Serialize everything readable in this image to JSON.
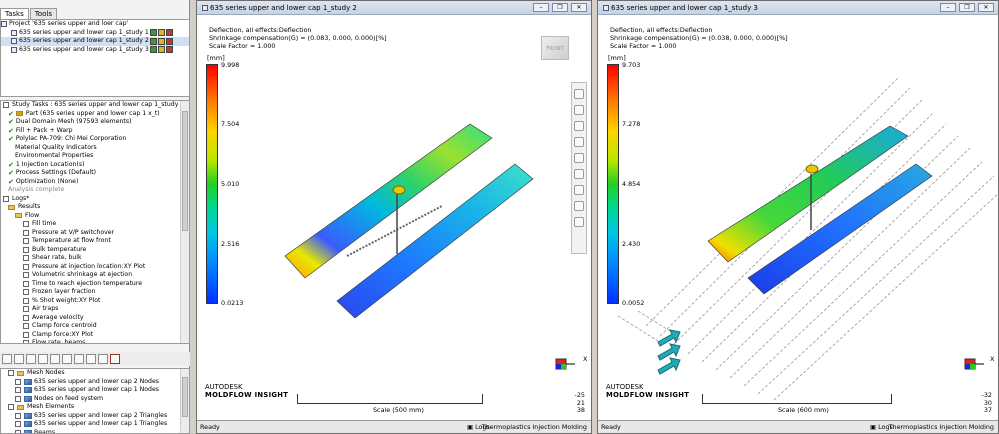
{
  "left": {
    "tabs": [
      "Tasks",
      "Tools"
    ],
    "project": {
      "title": "Project '635 series  upper and loer cap'",
      "studies": [
        {
          "label": "635 series  upper and lower cap 1_study 1",
          "selected": false
        },
        {
          "label": "635 series  upper and lower cap 1_study 2",
          "selected": true
        },
        {
          "label": "635 series  upper and lower cap 1_study 3",
          "selected": false
        }
      ]
    },
    "tasks": {
      "header": "Study Tasks : 635 series  upper and lower cap 1_study 2",
      "items": [
        {
          "label": "Part (635 series  upper and lower cap 1 x_t)",
          "indent": 1,
          "kind": "part"
        },
        {
          "label": "Dual Domain Mesh (97593 elements)",
          "indent": 1,
          "kind": "tick"
        },
        {
          "label": "Fill + Pack + Warp",
          "indent": 1,
          "kind": "tick"
        },
        {
          "label": "Polylac PA-709: Chi Mei Corporation",
          "indent": 1,
          "kind": "tick"
        },
        {
          "label": "Material Quality Indicators",
          "indent": 2,
          "kind": "none"
        },
        {
          "label": "Environmental Properties",
          "indent": 2,
          "kind": "none"
        },
        {
          "label": "1 Injection Location(s)",
          "indent": 1,
          "kind": "tick"
        },
        {
          "label": "Process Settings (Default)",
          "indent": 1,
          "kind": "tick"
        },
        {
          "label": "Optimization (None)",
          "indent": 1,
          "kind": "tick"
        },
        {
          "label": "Analysis complete",
          "indent": 1,
          "kind": "grey"
        },
        {
          "label": "Logs*",
          "indent": 0,
          "kind": "box"
        },
        {
          "label": "Results",
          "indent": 1,
          "kind": "folder"
        },
        {
          "label": "Flow",
          "indent": 2,
          "kind": "folder"
        },
        {
          "label": "Fill time",
          "indent": 3,
          "kind": "chk"
        },
        {
          "label": "Pressure at V/P switchover",
          "indent": 3,
          "kind": "chk"
        },
        {
          "label": "Temperature at flow front",
          "indent": 3,
          "kind": "chk"
        },
        {
          "label": "Bulk temperature",
          "indent": 3,
          "kind": "chk"
        },
        {
          "label": "Shear rate, bulk",
          "indent": 3,
          "kind": "chk"
        },
        {
          "label": "Pressure at injection location:XY Plot",
          "indent": 3,
          "kind": "chk"
        },
        {
          "label": "Volumetric shrinkage at ejection",
          "indent": 3,
          "kind": "chk"
        },
        {
          "label": "Time to reach ejection temperature",
          "indent": 3,
          "kind": "chk"
        },
        {
          "label": "Frozen layer fraction",
          "indent": 3,
          "kind": "chk"
        },
        {
          "label": "% Shot weight:XY Plot",
          "indent": 3,
          "kind": "chk"
        },
        {
          "label": "Air traps",
          "indent": 3,
          "kind": "chk"
        },
        {
          "label": "Average velocity",
          "indent": 3,
          "kind": "chk"
        },
        {
          "label": "Clamp force centroid",
          "indent": 3,
          "kind": "chk"
        },
        {
          "label": "Clamp force:XY Plot",
          "indent": 3,
          "kind": "chk"
        },
        {
          "label": "Flow rate, beams",
          "indent": 3,
          "kind": "chk"
        }
      ]
    },
    "layers": [
      {
        "label": "Mesh Nodes",
        "indent": 1,
        "kind": "folder"
      },
      {
        "label": "635 series  upper and lower cap 2 Nodes",
        "indent": 2,
        "kind": "layer"
      },
      {
        "label": "635 series  upper and lower cap 1 Nodes",
        "indent": 2,
        "kind": "layer"
      },
      {
        "label": "Nodes on feed system",
        "indent": 2,
        "kind": "layer"
      },
      {
        "label": "Mesh Elements",
        "indent": 1,
        "kind": "folder"
      },
      {
        "label": "635 series  upper and lower cap 2 Triangles",
        "indent": 2,
        "kind": "layer"
      },
      {
        "label": "635 series  upper and lower cap 1 Triangles",
        "indent": 2,
        "kind": "layer"
      },
      {
        "label": "Beams",
        "indent": 2,
        "kind": "layer"
      }
    ]
  },
  "win1": {
    "title": "635 series  upper and lower cap 1_study 2",
    "info": [
      "Deflection, all effects:Deflection",
      "Shrinkage compensation(G) = (0.083, 0.000, 0.000)[%]",
      "Scale Factor = 1.000"
    ],
    "unit": "[mm]",
    "ticks": [
      "9.998",
      "7.504",
      "5.010",
      "2.516",
      "0.0213"
    ],
    "scale": "Scale (500 mm)",
    "coords": [
      "-25",
      "21",
      "38"
    ],
    "status": "Ready",
    "logs": "Logs",
    "mode": "Thermoplastics Injection Molding",
    "brand1": "AUTODESK",
    "brand2": "MOLDFLOW INSIGHT",
    "cube": "FRONT",
    "axis_x": "X"
  },
  "win2": {
    "title": "635 series  upper and lower cap 1_study 3",
    "info": [
      "Deflection, all effects:Deflection",
      "Shrinkage compensation(G) = (0.038, 0.000, 0.000)[%]",
      "Scale Factor = 1.000"
    ],
    "unit": "[mm]",
    "ticks": [
      "9.703",
      "7.278",
      "4.854",
      "2.430",
      "0.0052"
    ],
    "scale": "Scale (600 mm)",
    "coords": [
      "-32",
      "30",
      "37"
    ],
    "status": "Ready",
    "logs": "Logs",
    "mode": "Thermoplastics Injection Molding",
    "brand1": "AUTODESK",
    "brand2": "MOLDFLOW INSIGHT",
    "axis_x": "X"
  }
}
